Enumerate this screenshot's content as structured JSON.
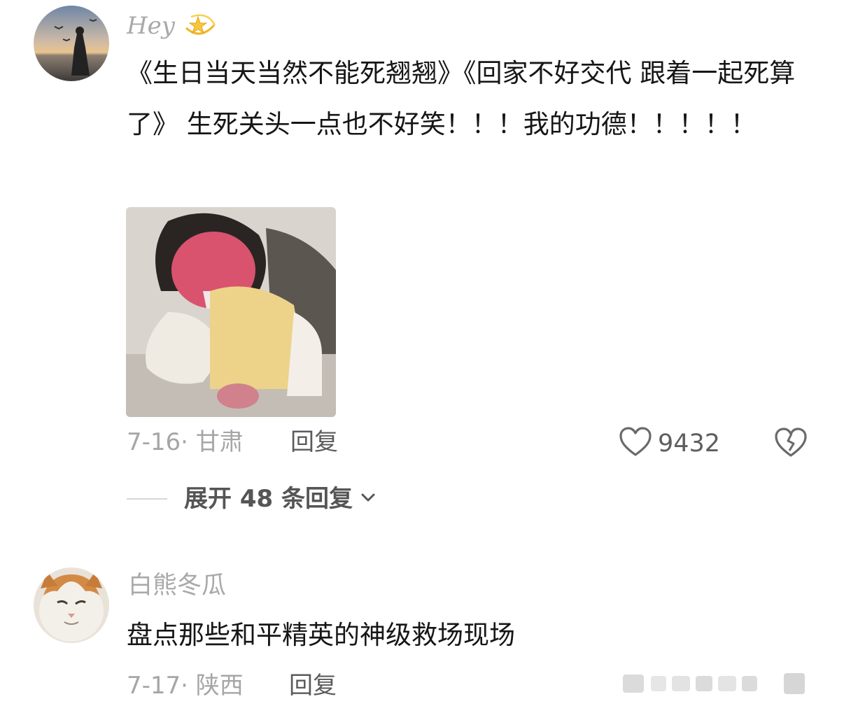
{
  "comments": [
    {
      "username": "Hey",
      "username_emoji": "dizzy-star-icon",
      "text": "《生日当天当然不能死翘翘》《回家不好交代 跟着一起死算了》 生死关头一点也不好笑！！！我的功德！！！！！",
      "date_location": "7-16· 甘肃",
      "reply_label": "回复",
      "like_count": "9432",
      "expand_replies": "展开 48 条回复"
    },
    {
      "username": "白熊冬瓜",
      "text": "盘点那些和平精英的神级救场现场",
      "date_location": "7-17· 陕西",
      "reply_label": "回复"
    }
  ],
  "colors": {
    "username": "#a9a9a9",
    "text": "#161616",
    "meta": "#a6a6a6",
    "action": "#5b5b5b"
  }
}
